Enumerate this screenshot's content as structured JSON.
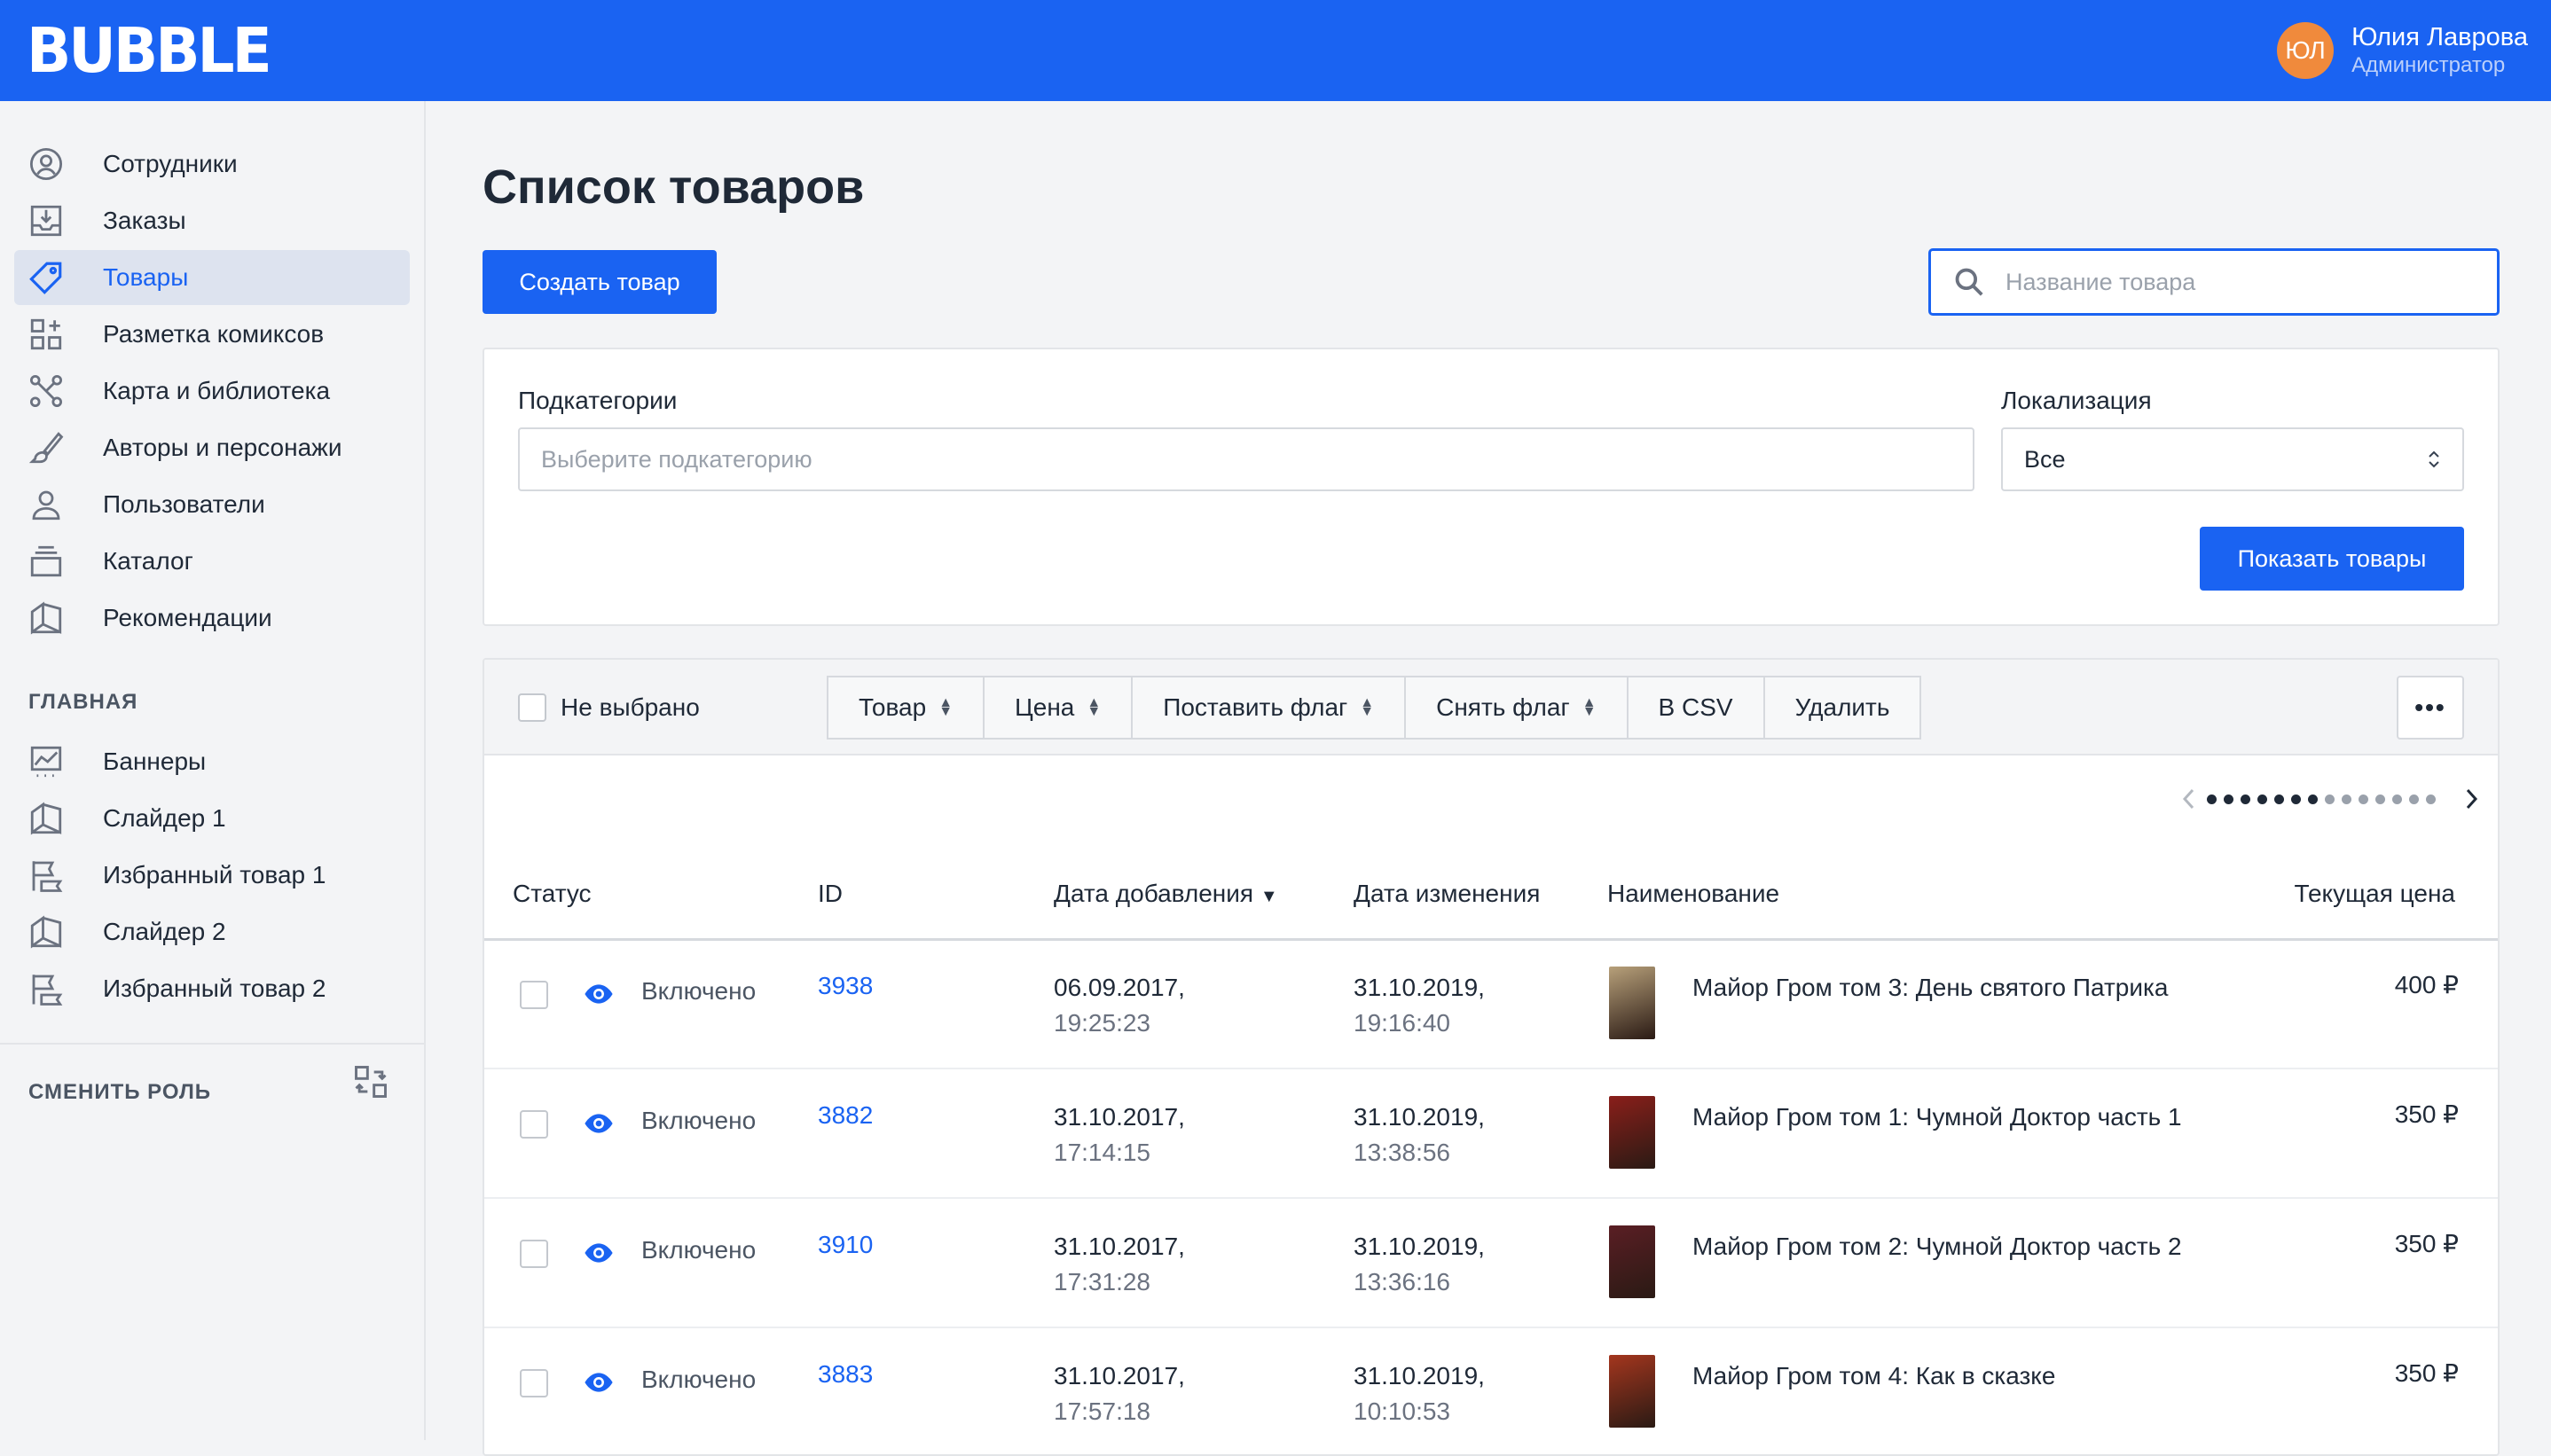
{
  "header": {
    "logo": "BUBBLE",
    "user_initials": "ЮЛ",
    "user_name": "Юлия Лаврова",
    "user_role": "Администратор"
  },
  "sidebar": {
    "items": [
      {
        "label": "Сотрудники",
        "icon": "user-circle-icon"
      },
      {
        "label": "Заказы",
        "icon": "inbox-download-icon"
      },
      {
        "label": "Товары",
        "icon": "tag-icon",
        "active": true
      },
      {
        "label": "Разметка комиксов",
        "icon": "grid-add-icon"
      },
      {
        "label": "Карта и библиотека",
        "icon": "nodes-icon"
      },
      {
        "label": "Авторы и персонажи",
        "icon": "brush-icon"
      },
      {
        "label": "Пользователи",
        "icon": "user-icon"
      },
      {
        "label": "Каталог",
        "icon": "stack-icon"
      },
      {
        "label": "Рекомендации",
        "icon": "book-open-icon"
      }
    ],
    "section_main": "ГЛАВНАЯ",
    "main_items": [
      {
        "label": "Баннеры",
        "icon": "chart-icon"
      },
      {
        "label": "Слайдер 1",
        "icon": "book-open-icon"
      },
      {
        "label": "Избранный товар 1",
        "icon": "flag-icon"
      },
      {
        "label": "Слайдер 2",
        "icon": "book-open-icon"
      },
      {
        "label": "Избранный товар 2",
        "icon": "flag-icon"
      }
    ],
    "change_role": "СМЕНИТЬ РОЛЬ"
  },
  "main": {
    "title": "Список товаров",
    "create_button": "Создать товар",
    "search_placeholder": "Название товара",
    "filters": {
      "subcategory_label": "Подкатегории",
      "subcategory_placeholder": "Выберите подкатегорию",
      "locale_label": "Локализация",
      "locale_value": "Все",
      "show_button": "Показать товары"
    },
    "toolbar": {
      "select_label": "Не выбрано",
      "buttons": [
        "Товар",
        "Цена",
        "Поставить флаг",
        "Снять флаг",
        "В CSV",
        "Удалить"
      ],
      "more": "•••"
    },
    "pagination": {
      "total_dots": 14,
      "current": 7
    },
    "columns": [
      "Статус",
      "ID",
      "Дата добавления",
      "Дата изменения",
      "Наименование",
      "Текущая цена"
    ],
    "rows": [
      {
        "status": "Включено",
        "id": "3938",
        "added_date": "06.09.2017,",
        "added_time": "19:25:23",
        "changed_date": "31.10.2019,",
        "changed_time": "19:16:40",
        "name": "Майор Гром том 3: День святого Патрика",
        "price": "400 ₽",
        "thumb_color": "#b7a07a"
      },
      {
        "status": "Включено",
        "id": "3882",
        "added_date": "31.10.2017,",
        "added_time": "17:14:15",
        "changed_date": "31.10.2019,",
        "changed_time": "13:38:56",
        "name": "Майор Гром том 1: Чумной Доктор часть 1",
        "price": "350 ₽",
        "thumb_color": "#8a1f1a"
      },
      {
        "status": "Включено",
        "id": "3910",
        "added_date": "31.10.2017,",
        "added_time": "17:31:28",
        "changed_date": "31.10.2019,",
        "changed_time": "13:36:16",
        "name": "Майор Гром том 2: Чумной Доктор часть 2",
        "price": "350 ₽",
        "thumb_color": "#5a1e24"
      },
      {
        "status": "Включено",
        "id": "3883",
        "added_date": "31.10.2017,",
        "added_time": "17:57:18",
        "changed_date": "31.10.2019,",
        "changed_time": "10:10:53",
        "name": "Майор Гром том 4: Как в сказке",
        "price": "350 ₽",
        "thumb_color": "#a4361e"
      }
    ]
  },
  "colors": {
    "brand": "#1a63f2",
    "avatar": "#f08a3c"
  }
}
